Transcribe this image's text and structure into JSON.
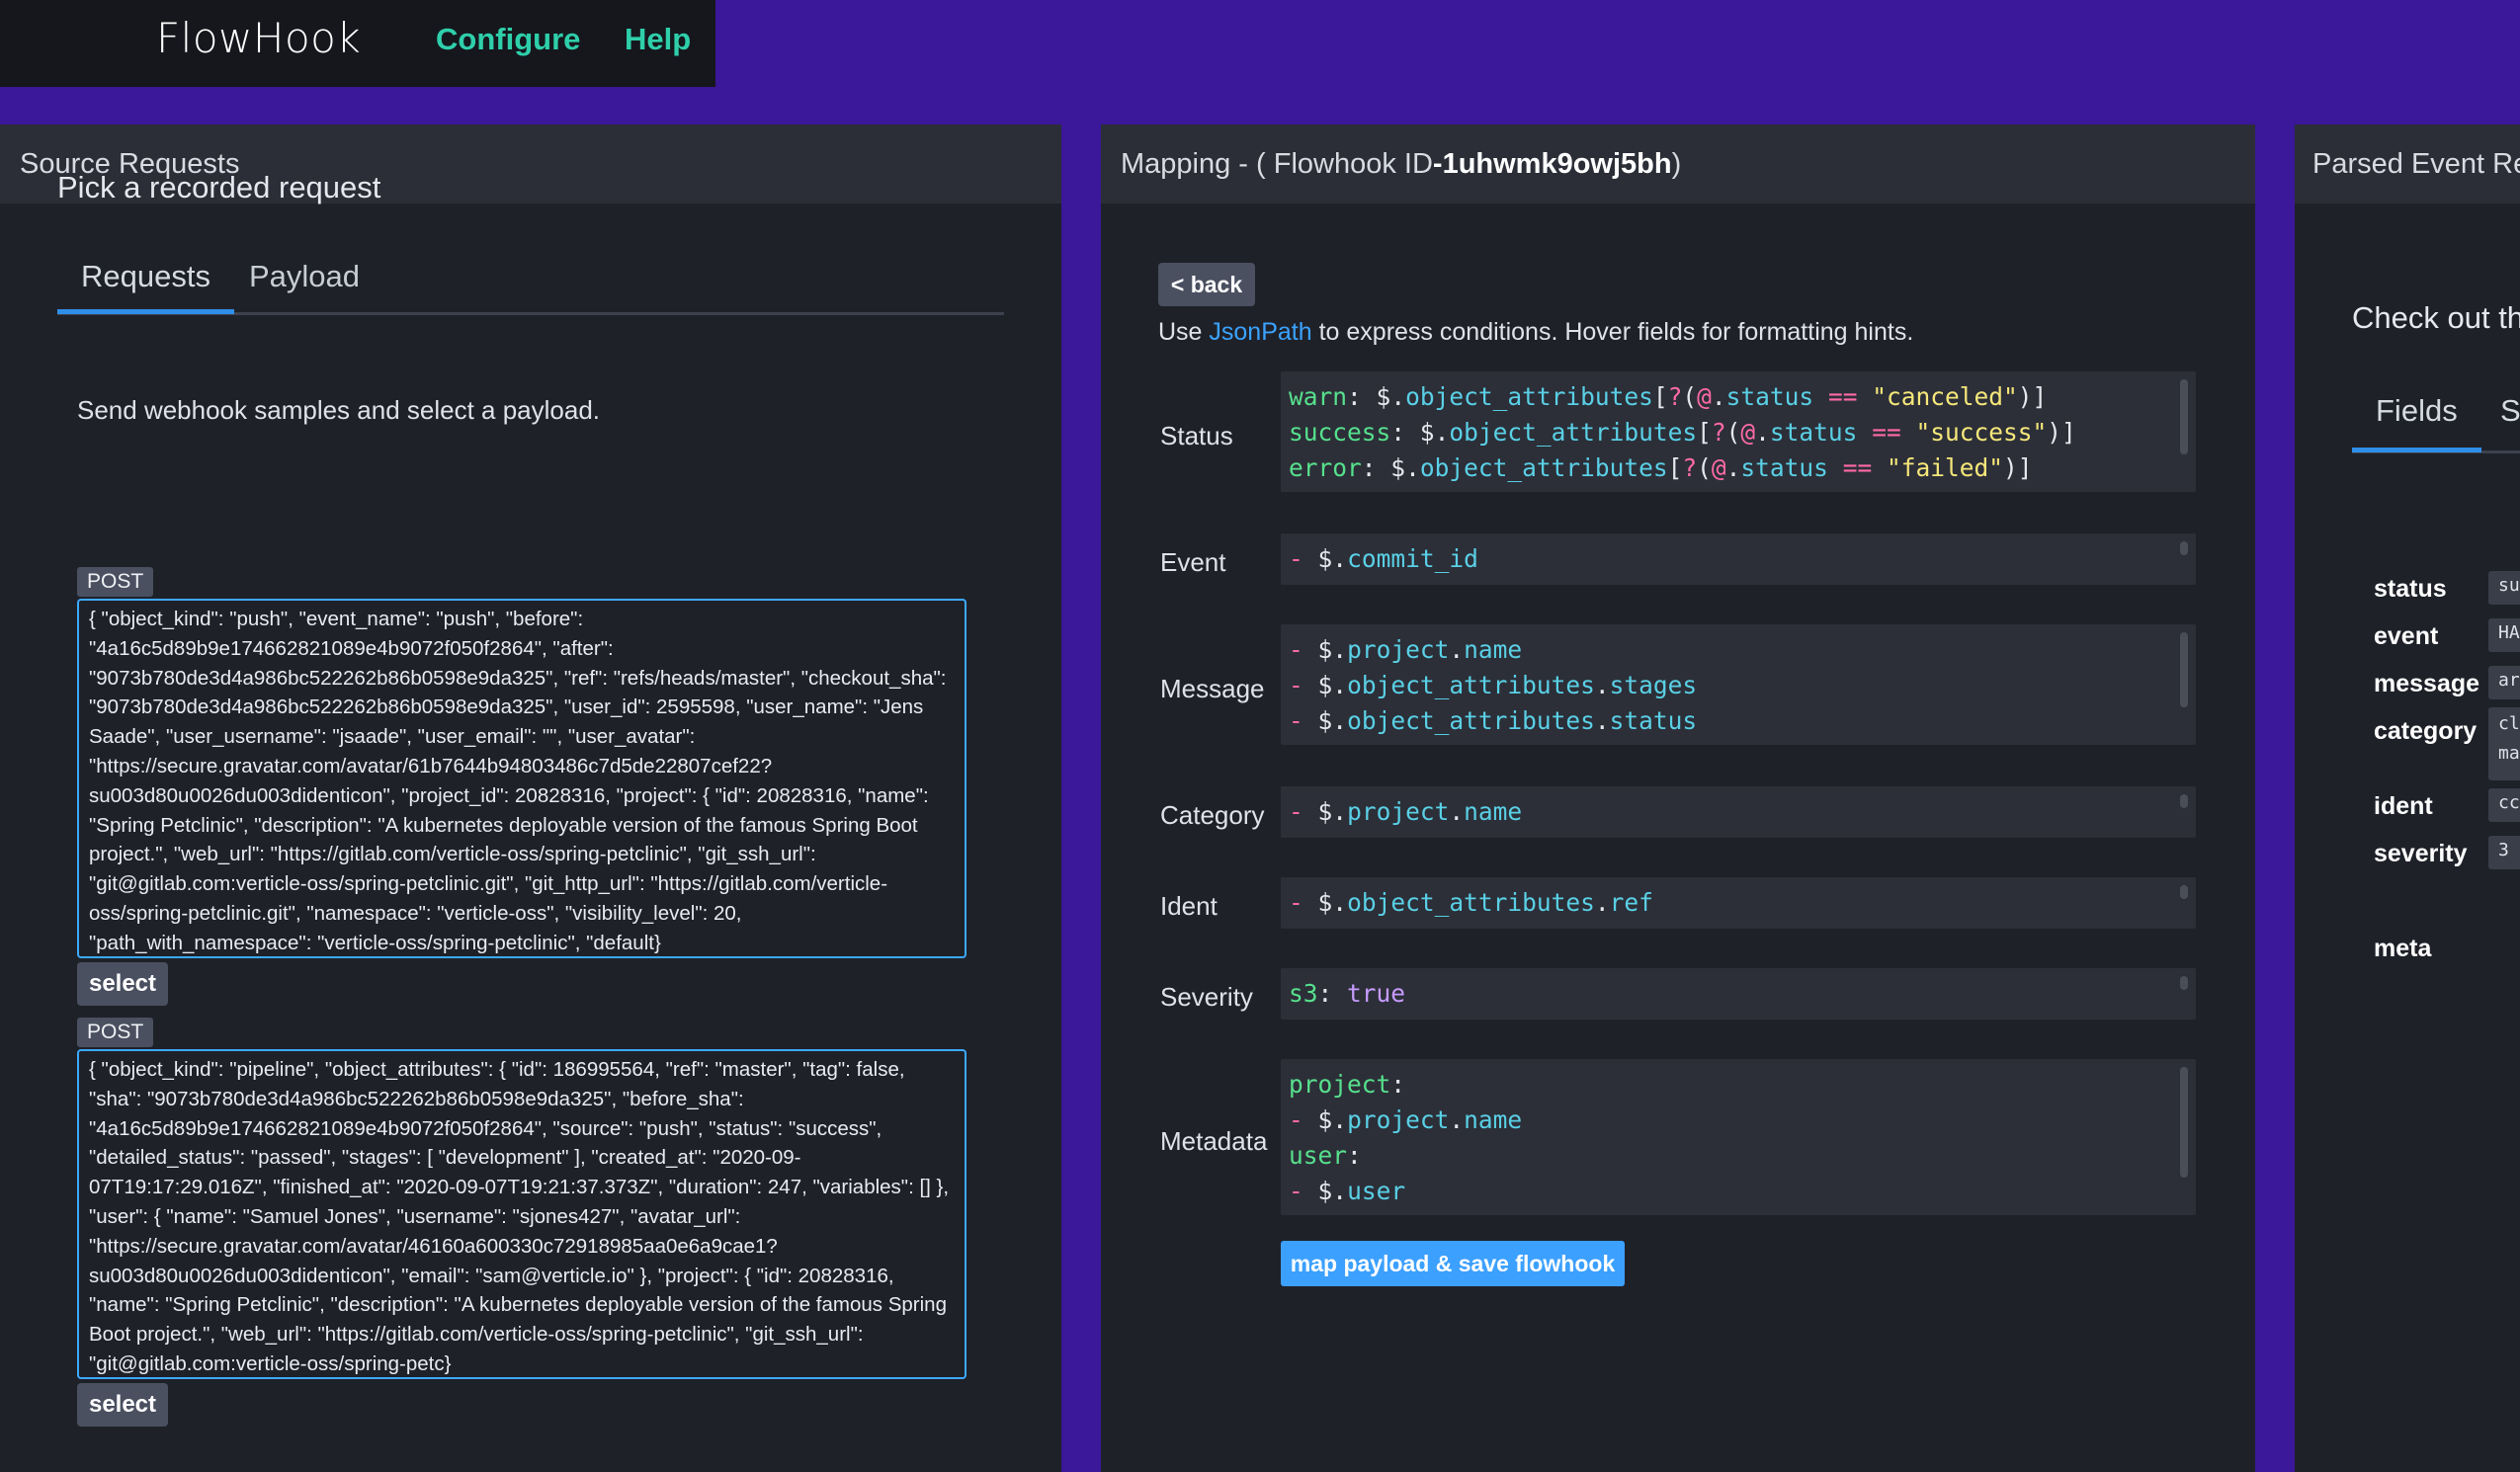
{
  "nav": {
    "logo": "FlowHook",
    "links": [
      "Configure",
      "Help"
    ]
  },
  "source": {
    "header": "Source Requests",
    "pick_title": "Pick a recorded request",
    "tabs": [
      "Requests",
      "Payload"
    ],
    "hint": "Send webhook samples and select a payload.",
    "requests": [
      {
        "method": "POST",
        "body": "{ \"object_kind\": \"push\", \"event_name\": \"push\", \"before\": \"4a16c5d89b9e174662821089e4b9072f050f2864\", \"after\": \"9073b780de3d4a986bc522262b86b0598e9da325\", \"ref\": \"refs/heads/master\", \"checkout_sha\": \"9073b780de3d4a986bc522262b86b0598e9da325\", \"user_id\": 2595598, \"user_name\": \"Jens Saade\", \"user_username\": \"jsaade\", \"user_email\": \"\", \"user_avatar\": \"https://secure.gravatar.com/avatar/61b7644b94803486c7d5de22807cef22?su003d80u0026du003didenticon\", \"project_id\": 20828316, \"project\": { \"id\": 20828316, \"name\": \"Spring Petclinic\", \"description\": \"A kubernetes deployable version of the famous Spring Boot project.\", \"web_url\": \"https://gitlab.com/verticle-oss/spring-petclinic\", \"git_ssh_url\": \"git@gitlab.com:verticle-oss/spring-petclinic.git\", \"git_http_url\": \"https://gitlab.com/verticle-oss/spring-petclinic.git\", \"namespace\": \"verticle-oss\", \"visibility_level\": 20, \"path_with_namespace\": \"verticle-oss/spring-petclinic\", \"default}",
        "select_label": "select"
      },
      {
        "method": "POST",
        "body": "{ \"object_kind\": \"pipeline\", \"object_attributes\": { \"id\": 186995564, \"ref\": \"master\", \"tag\": false, \"sha\": \"9073b780de3d4a986bc522262b86b0598e9da325\", \"before_sha\": \"4a16c5d89b9e174662821089e4b9072f050f2864\", \"source\": \"push\", \"status\": \"success\", \"detailed_status\": \"passed\", \"stages\": [ \"development\" ], \"created_at\": \"2020-09-07T19:17:29.016Z\", \"finished_at\": \"2020-09-07T19:21:37.373Z\", \"duration\": 247, \"variables\": [] }, \"user\": { \"name\": \"Samuel Jones\", \"username\": \"sjones427\", \"avatar_url\": \"https://secure.gravatar.com/avatar/46160a600330c72918985aa0e6a9cae1?su003d80u0026du003didenticon\", \"email\": \"sam@verticle.io\" }, \"project\": { \"id\": 20828316, \"name\": \"Spring Petclinic\", \"description\": \"A kubernetes deployable version of the famous Spring Boot project.\", \"web_url\": \"https://gitlab.com/verticle-oss/spring-petclinic\", \"git_ssh_url\": \"git@gitlab.com:verticle-oss/spring-petc}",
        "select_label": "select"
      }
    ]
  },
  "mapping": {
    "header_prefix": "Mapping - ( Flowhook ID ",
    "flowhook_id": "-1uhwmk9owj5bh",
    "header_suffix": ")",
    "back_label": "< back",
    "use_prefix": "Use ",
    "use_link": "JsonPath",
    "use_suffix": " to express conditions. Hover fields for formatting hints.",
    "fields": [
      {
        "label": "Status",
        "lines": [
          "warn: $.object_attributes[?(@.status == \"canceled\")]",
          "success: $.object_attributes[?(@.status == \"success\")]",
          "error: $.object_attributes[?(@.status == \"failed\")]"
        ]
      },
      {
        "label": "Event",
        "lines": [
          "- $.commit_id"
        ]
      },
      {
        "label": "Message",
        "lines": [
          "- $.project.name",
          "- $.object_attributes.stages",
          "- $.object_attributes.status"
        ]
      },
      {
        "label": "Category",
        "lines": [
          "- $.project.name"
        ]
      },
      {
        "label": "Ident",
        "lines": [
          "- $.object_attributes.ref"
        ]
      },
      {
        "label": "Severity",
        "lines": [
          "s3: true"
        ]
      },
      {
        "label": "Metadata",
        "lines": [
          "project:",
          "- $.project.name",
          "user:",
          "- $.user"
        ]
      }
    ],
    "save_label": "map payload & save flowhook"
  },
  "parsed": {
    "header": "Parsed Event Re",
    "check": "Check out th",
    "tabs": [
      "Fields",
      "St"
    ],
    "fields": [
      {
        "label": "status",
        "value": "su"
      },
      {
        "label": "event",
        "value": "HA"
      },
      {
        "label": "message",
        "value": "ar"
      },
      {
        "label": "category",
        "value": "cl ma"
      },
      {
        "label": "ident",
        "value": "cc"
      },
      {
        "label": "severity",
        "value": "3"
      },
      {
        "label": "meta",
        "value": ""
      }
    ]
  },
  "colors": {
    "background": "#3b1799",
    "accent_green": "#2ecfaa",
    "accent_blue": "#3ca0ff"
  }
}
